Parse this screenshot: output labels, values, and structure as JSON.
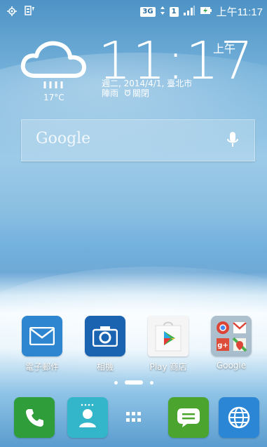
{
  "statusbar": {
    "network_label": "3G",
    "sim_label": "1",
    "time": "上午11:17",
    "icons": [
      "location-icon",
      "sim-battery-icon",
      "network-icon",
      "signal-icon",
      "battery-charging-icon"
    ]
  },
  "weather": {
    "temperature": "17°C",
    "condition": "陣雨",
    "icon": "rain-cloud-icon"
  },
  "clock": {
    "time": "11:17",
    "ampm": "上午",
    "date_line": "週二, 2014/4/1, 臺北市",
    "alarm_label": "關閉"
  },
  "search": {
    "logo_text": "Google",
    "icon": "microphone-icon"
  },
  "apps": [
    {
      "label": "電子郵件",
      "icon": "mail-icon",
      "color": "#2e86d1"
    },
    {
      "label": "相機",
      "icon": "camera-icon",
      "color": "#1a63b0"
    },
    {
      "label": "Play 商店",
      "icon": "play-store-icon",
      "color": "#f5f5f5"
    },
    {
      "label": "Google",
      "icon": "google-folder-icon",
      "color": "#8fa7b9"
    }
  ],
  "dock": [
    {
      "name": "phone",
      "icon": "phone-icon",
      "color": "#2f9e3a"
    },
    {
      "name": "contacts",
      "icon": "contacts-icon",
      "color": "#33b6c9"
    },
    {
      "name": "app-drawer",
      "icon": "grid-icon",
      "color": "transparent"
    },
    {
      "name": "messages",
      "icon": "message-icon",
      "color": "#4aa42d"
    },
    {
      "name": "browser",
      "icon": "globe-icon",
      "color": "#2b86d6"
    }
  ]
}
